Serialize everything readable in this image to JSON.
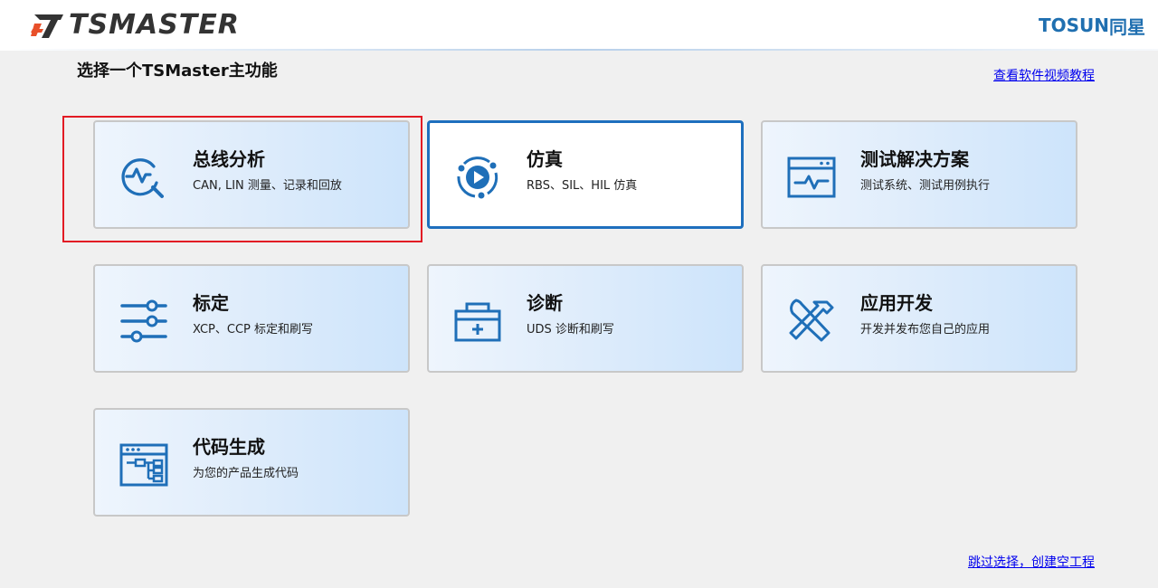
{
  "header": {
    "logo_text": "TSMASTER",
    "brand_en": "TOSUN",
    "brand_cn": "同星"
  },
  "page": {
    "title": "选择一个TSMaster主功能",
    "tutorial_link": "查看软件视频教程",
    "skip_link": "跳过选择，创建空工程"
  },
  "cards": [
    {
      "title": "总线分析",
      "subtitle": "CAN, LIN 测量、记录和回放",
      "icon": "bus-analysis-icon"
    },
    {
      "title": "仿真",
      "subtitle": "RBS、SIL、HIL 仿真",
      "icon": "simulation-play-icon"
    },
    {
      "title": "测试解决方案",
      "subtitle": "测试系统、测试用例执行",
      "icon": "test-window-icon"
    },
    {
      "title": "标定",
      "subtitle": "XCP、CCP 标定和刷写",
      "icon": "sliders-icon"
    },
    {
      "title": "诊断",
      "subtitle": "UDS 诊断和刷写",
      "icon": "medical-box-icon"
    },
    {
      "title": "应用开发",
      "subtitle": "开发并发布您自己的应用",
      "icon": "tools-icon"
    },
    {
      "title": "代码生成",
      "subtitle": "为您的产品生成代码",
      "icon": "code-tree-icon"
    }
  ],
  "selected_card": "仿真",
  "highlighted_card": "总线分析",
  "colors": {
    "accent": "#1e6fbe",
    "icon": "#1f6fb8",
    "highlight": "#e21b24",
    "logo_accent": "#e8502a"
  }
}
